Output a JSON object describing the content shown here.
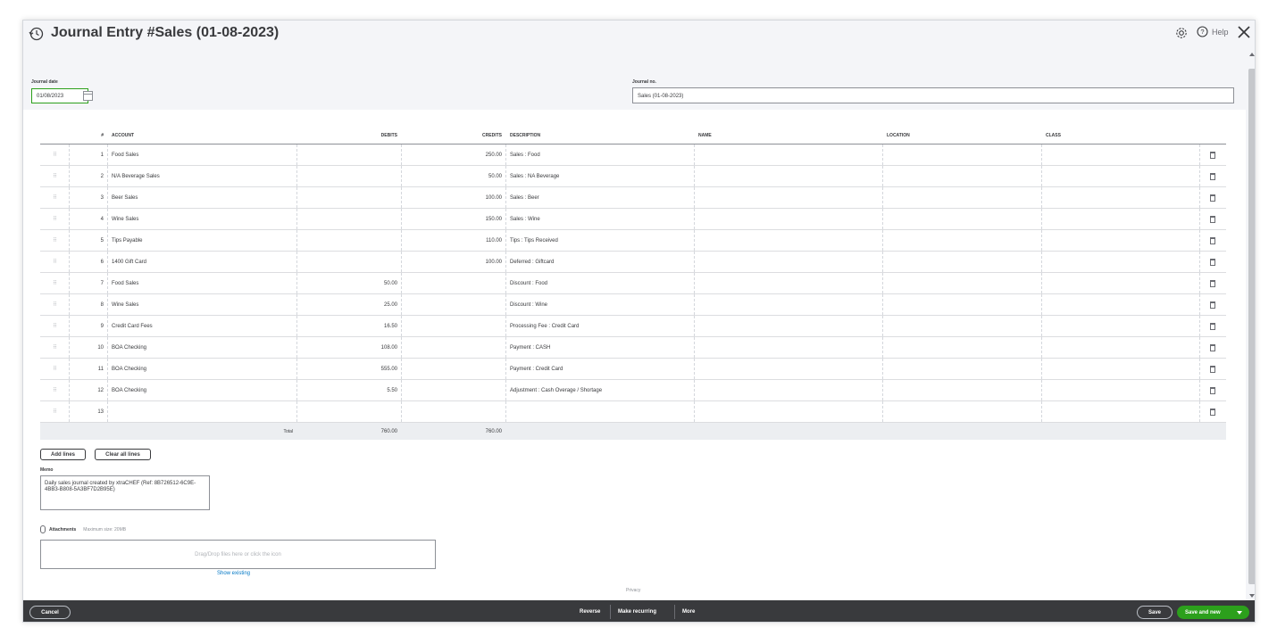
{
  "header": {
    "title": "Journal Entry #Sales (01-08-2023)",
    "help_label": "Help"
  },
  "form": {
    "journal_date_label": "Journal date",
    "journal_date_value": "01/08/2023",
    "journal_no_label": "Journal no.",
    "journal_no_value": "Sales (01-08-2023)"
  },
  "table": {
    "headers": {
      "num": "#",
      "account": "ACCOUNT",
      "debits": "DEBITS",
      "credits": "CREDITS",
      "description": "DESCRIPTION",
      "name": "NAME",
      "location": "LOCATION",
      "class": "CLASS"
    },
    "drag_glyph": "⠿",
    "rows": [
      {
        "num": "1",
        "account": "Food Sales",
        "debit": "",
        "credit": "250.00",
        "description": "Sales : Food",
        "name": "",
        "location": "",
        "class": ""
      },
      {
        "num": "2",
        "account": "N/A Beverage Sales",
        "debit": "",
        "credit": "50.00",
        "description": "Sales : NA Beverage",
        "name": "",
        "location": "",
        "class": ""
      },
      {
        "num": "3",
        "account": "Beer Sales",
        "debit": "",
        "credit": "100.00",
        "description": "Sales : Beer",
        "name": "",
        "location": "",
        "class": ""
      },
      {
        "num": "4",
        "account": "Wine Sales",
        "debit": "",
        "credit": "150.00",
        "description": "Sales : Wine",
        "name": "",
        "location": "",
        "class": ""
      },
      {
        "num": "5",
        "account": "Tips Payable",
        "debit": "",
        "credit": "110.00",
        "description": "Tips : Tips Received",
        "name": "",
        "location": "",
        "class": ""
      },
      {
        "num": "6",
        "account": "1400 Gift Card",
        "debit": "",
        "credit": "100.00",
        "description": "Deferred : Giftcard",
        "name": "",
        "location": "",
        "class": ""
      },
      {
        "num": "7",
        "account": "Food Sales",
        "debit": "50.00",
        "credit": "",
        "description": "Discount : Food",
        "name": "",
        "location": "",
        "class": ""
      },
      {
        "num": "8",
        "account": "Wine Sales",
        "debit": "25.00",
        "credit": "",
        "description": "Discount : Wine",
        "name": "",
        "location": "",
        "class": ""
      },
      {
        "num": "9",
        "account": "Credit Card Fees",
        "debit": "16.50",
        "credit": "",
        "description": "Processing Fee : Credit Card",
        "name": "",
        "location": "",
        "class": ""
      },
      {
        "num": "10",
        "account": "BOA Checking",
        "debit": "108.00",
        "credit": "",
        "description": "Payment : CASH",
        "name": "",
        "location": "",
        "class": ""
      },
      {
        "num": "11",
        "account": "BOA Checking",
        "debit": "555.00",
        "credit": "",
        "description": "Payment : Credit Card",
        "name": "",
        "location": "",
        "class": ""
      },
      {
        "num": "12",
        "account": "BOA Checking",
        "debit": "5.50",
        "credit": "",
        "description": "Adjustment : Cash Overage / Shortage",
        "name": "",
        "location": "",
        "class": ""
      },
      {
        "num": "13",
        "account": "",
        "debit": "",
        "credit": "",
        "description": "",
        "name": "",
        "location": "",
        "class": ""
      }
    ],
    "total_label": "Total",
    "total_debits": "760.00",
    "total_credits": "760.00"
  },
  "actions": {
    "add_lines": "Add lines",
    "clear_all_lines": "Clear all lines"
  },
  "memo": {
    "label": "Memo",
    "value": "Daily sales journal created by xtraCHEF (Ref: 8B726512-6C9E-4BB3-B808-5A3BF7D2B95E)"
  },
  "attachments": {
    "label": "Attachments",
    "max_size": "Maximum size: 20MB",
    "dropzone_text": "Drag/Drop files here or click the icon",
    "show_existing": "Show existing"
  },
  "privacy_label": "Privacy",
  "footer": {
    "cancel": "Cancel",
    "reverse": "Reverse",
    "make_recurring": "Make recurring",
    "more": "More",
    "save": "Save",
    "save_and_new": "Save and new"
  },
  "colors": {
    "brand_green": "#2ca01c",
    "footer_bg": "#393a3d",
    "link_blue": "#0077c5"
  }
}
